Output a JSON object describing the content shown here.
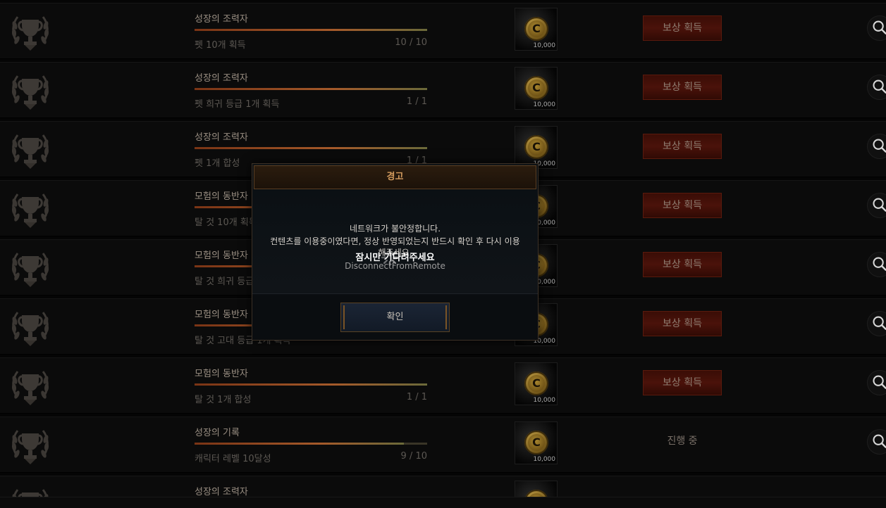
{
  "rows": [
    {
      "title": "성장의 조력자",
      "desc": "펫 10개 획득",
      "count": "10 / 10",
      "progress": 1.0,
      "reward_qty": "10,000",
      "action": "보상 획득",
      "state": "claim"
    },
    {
      "title": "성장의 조력자",
      "desc": "펫 희귀 등급 1개 획득",
      "count": "1 / 1",
      "progress": 1.0,
      "reward_qty": "10,000",
      "action": "보상 획득",
      "state": "claim"
    },
    {
      "title": "성장의 조력자",
      "desc": "펫 1개 합성",
      "count": "1 / 1",
      "progress": 1.0,
      "reward_qty": "10,000",
      "action": "보상 획득",
      "state": "claim"
    },
    {
      "title": "모험의 동반자",
      "desc": "탈 것 10개 획득",
      "count": "",
      "progress": 1.0,
      "reward_qty": "10,000",
      "action": "보상 획득",
      "state": "claim"
    },
    {
      "title": "모험의 동반자",
      "desc": "탈 것 희귀 등급 1개 획득",
      "count": "",
      "progress": 1.0,
      "reward_qty": "10,000",
      "action": "보상 획득",
      "state": "claim"
    },
    {
      "title": "모험의 동반자",
      "desc": "탈 것 고대 등급 1개 획득",
      "count": "",
      "progress": 1.0,
      "reward_qty": "10,000",
      "action": "보상 획득",
      "state": "claim"
    },
    {
      "title": "모험의 동반자",
      "desc": "탈 것 1개 합성",
      "count": "1 / 1",
      "progress": 1.0,
      "reward_qty": "10,000",
      "action": "보상 획득",
      "state": "claim"
    },
    {
      "title": "성장의 기록",
      "desc": "캐릭터 레벨 10달성",
      "count": "9 / 10",
      "progress": 0.9,
      "reward_qty": "10,000",
      "action": "진행 중",
      "state": "progress"
    },
    {
      "title": "성장의 조력자",
      "desc": "",
      "count": "",
      "progress": 0,
      "reward_qty": "",
      "action": "",
      "state": "partial"
    }
  ],
  "coin_glyph": "C",
  "dialog": {
    "title": "경고",
    "message_line1": "네트워크가 불안정합니다.",
    "message_line2": "컨텐츠를 이용중이였다면, 정상 반영되었는지 반드시 확인 후 다시 이용",
    "message_line3": "해주세요.",
    "loading_text": "잠시만 기다려주세요",
    "loading_sub": "DisconnectFromRemote",
    "confirm_label": "확인"
  },
  "icons": {
    "emblem": "trophy-laurel-emblem-icon",
    "search": "magnifier-icon",
    "spinner": "loading-spinner-icon",
    "coin": "coin-icon"
  },
  "colors": {
    "accent": "#d39b5e",
    "claim_bg": "#4a120a",
    "progress_fill": "#a55a2a"
  }
}
